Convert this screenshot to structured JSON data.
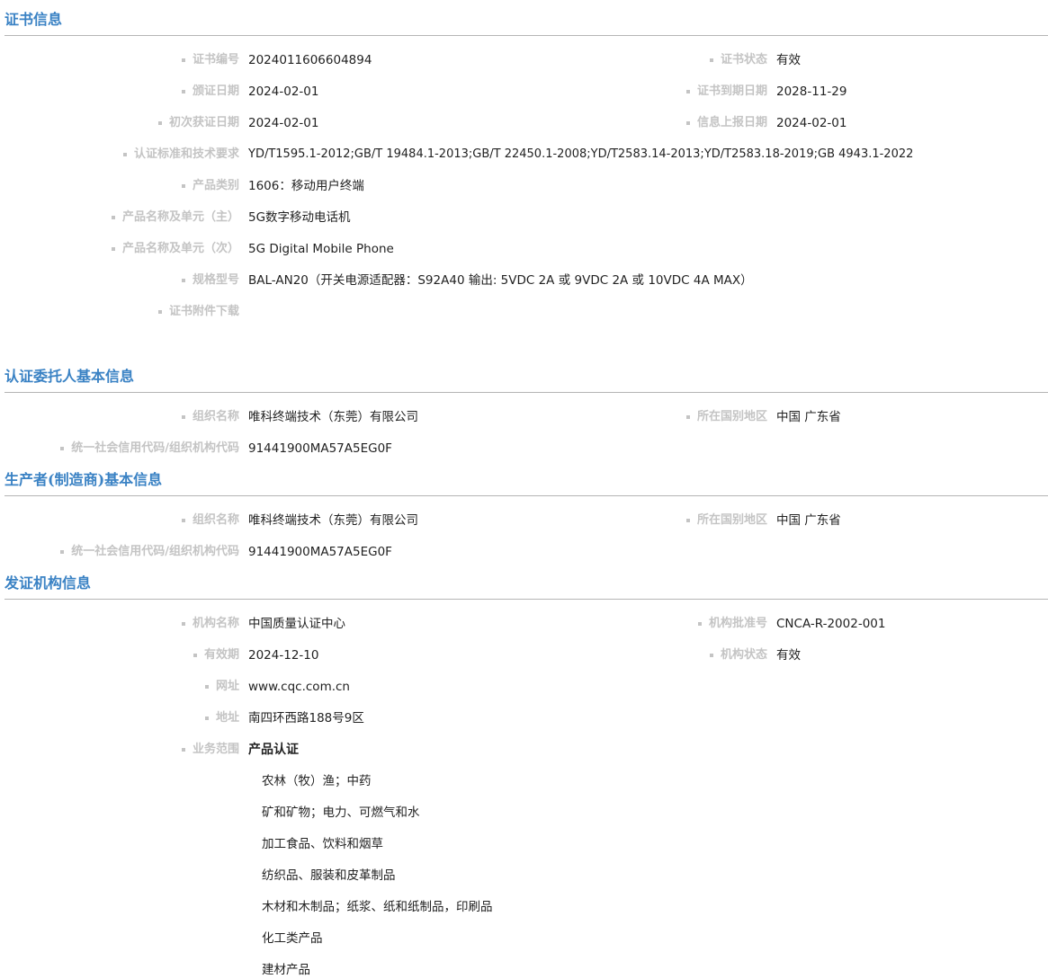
{
  "cert_section": {
    "title": "证书信息",
    "cert_no_label": "证书编号",
    "cert_no": "2024011606604894",
    "cert_status_label": "证书状态",
    "cert_status": "有效",
    "issue_date_label": "颁证日期",
    "issue_date": "2024-02-01",
    "expiry_label": "证书到期日期",
    "expiry": "2028-11-29",
    "first_date_label": "初次获证日期",
    "first_date": "2024-02-01",
    "report_date_label": "信息上报日期",
    "report_date": "2024-02-01",
    "standards_label": "认证标准和技术要求",
    "standards": "YD/T1595.1-2012;GB/T 19484.1-2013;GB/T 22450.1-2008;YD/T2583.14-2013;YD/T2583.18-2019;GB 4943.1-2022",
    "category_label": "产品类别",
    "category": "1606：移动用户终端",
    "name_main_label": "产品名称及单元（主）",
    "name_main": "5G数字移动电话机",
    "name_sub_label": "产品名称及单元（次）",
    "name_sub": "5G Digital Mobile Phone",
    "model_label": "规格型号",
    "model": "BAL-AN20（开关电源适配器：S92A40 输出: 5VDC 2A 或 9VDC 2A 或 10VDC 4A MAX）",
    "attachment_label": "证书附件下载"
  },
  "client_section": {
    "title": "认证委托人基本信息",
    "org_label": "组织名称",
    "org": "唯科终端技术（东莞）有限公司",
    "region_label": "所在国别地区",
    "region": "中国 广东省",
    "code_label": "统一社会信用代码/组织机构代码",
    "code": "91441900MA57A5EG0F"
  },
  "producer_section": {
    "title": "生产者(制造商)基本信息",
    "org_label": "组织名称",
    "org": "唯科终端技术（东莞）有限公司",
    "region_label": "所在国别地区",
    "region": "中国 广东省",
    "code_label": "统一社会信用代码/组织机构代码",
    "code": "91441900MA57A5EG0F"
  },
  "issuer_section": {
    "title": "发证机构信息",
    "name_label": "机构名称",
    "name": "中国质量认证中心",
    "approval_label": "机构批准号",
    "approval": "CNCA-R-2002-001",
    "valid_label": "有效期",
    "valid": "2024-12-10",
    "status_label": "机构状态",
    "status": "有效",
    "website_label": "网址",
    "website": "www.cqc.com.cn",
    "address_label": "地址",
    "address": "南四环西路188号9区",
    "scope_label": "业务范围",
    "scope_heading": "产品认证",
    "scope_items": [
      "农林（牧）渔；中药",
      "矿和矿物；电力、可燃气和水",
      "加工食品、饮料和烟草",
      "纺织品、服装和皮革制品",
      "木材和木制品；纸浆、纸和纸制品，印刷品",
      "化工类产品",
      "建材产品"
    ]
  }
}
